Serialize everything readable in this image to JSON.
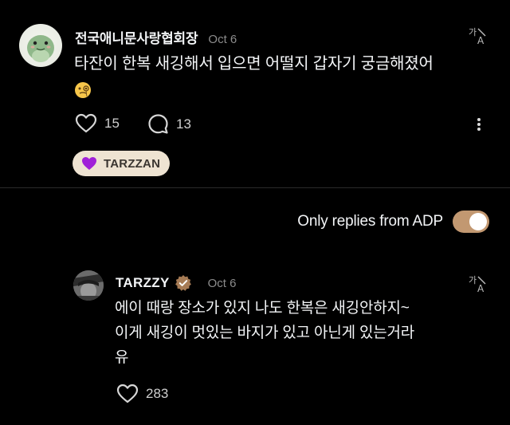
{
  "post": {
    "username": "전국애니문사랑협회장",
    "timestamp": "Oct 6",
    "text": "타잔이 한복 새깅해서 입으면 어떨지 갑자기 궁금해졌어",
    "emoji_icon": "face-with-monocle-icon",
    "likes": "15",
    "replies": "13",
    "tag": {
      "label": "TARZZAN",
      "icon": "purple-heart-icon",
      "color": "#a020d8"
    }
  },
  "filter": {
    "label": "Only replies from ADP",
    "enabled": true,
    "accent_color": "#c29871"
  },
  "reply": {
    "username": "TARZZY",
    "verified_icon": "verified-badge-icon",
    "timestamp": "Oct 6",
    "lines": [
      "에이 때랑 장소가 있지 나도 한복은 새깅안하지~",
      "이게 새깅이 멋있는 바지가 있고 아닌게 있는거라",
      "유"
    ],
    "likes": "283"
  }
}
